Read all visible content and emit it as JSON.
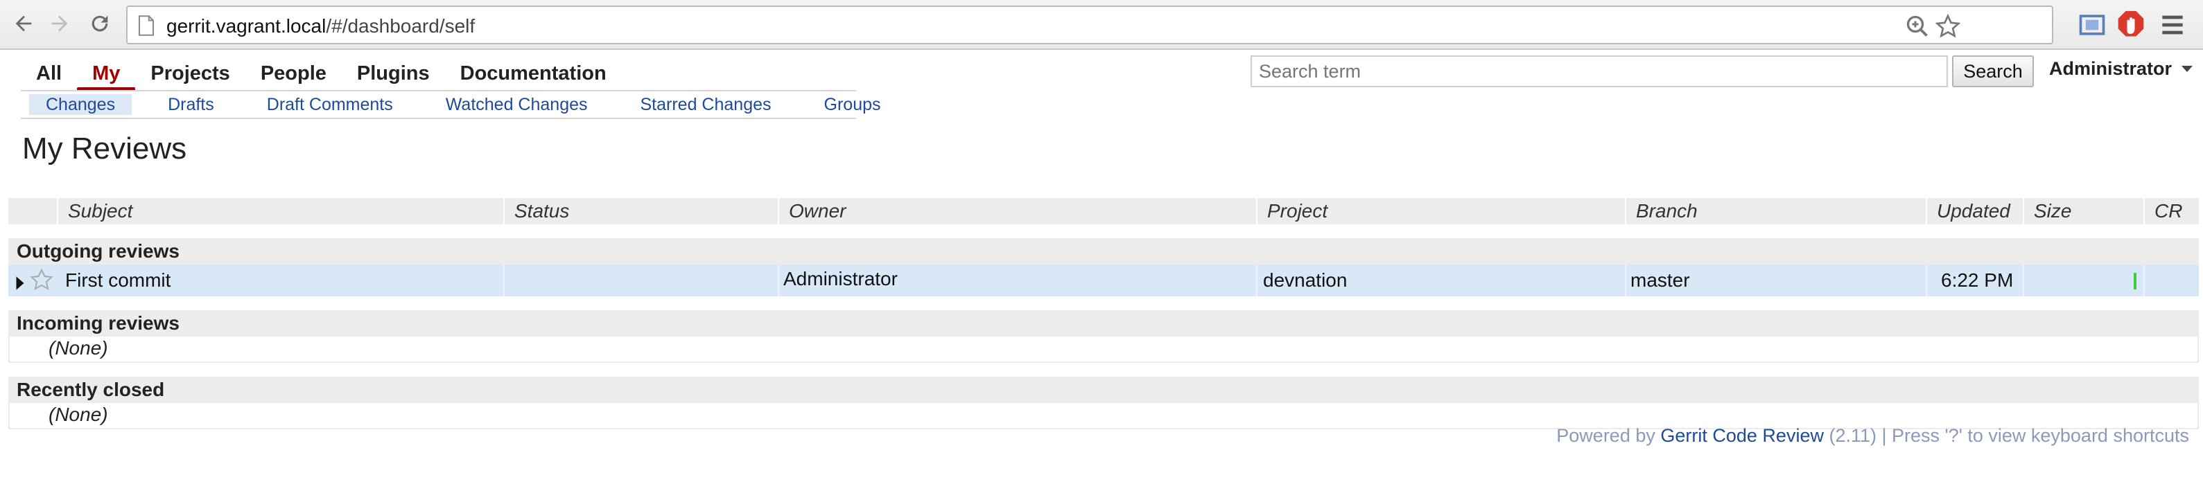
{
  "browser": {
    "url_host": "gerrit.vagrant.local",
    "url_path": "/#/dashboard/self"
  },
  "topmenu": {
    "items": [
      "All",
      "My",
      "Projects",
      "People",
      "Plugins",
      "Documentation"
    ],
    "active": "My"
  },
  "submenu": {
    "items": [
      "Changes",
      "Drafts",
      "Draft Comments",
      "Watched Changes",
      "Starred Changes",
      "Groups"
    ],
    "active": "Changes"
  },
  "search": {
    "placeholder": "Search term",
    "button_label": "Search"
  },
  "user": {
    "name": "Administrator"
  },
  "page": {
    "title": "My Reviews"
  },
  "table": {
    "columns": [
      "Subject",
      "Status",
      "Owner",
      "Project",
      "Branch",
      "Updated",
      "Size",
      "CR"
    ],
    "sections": [
      {
        "title": "Outgoing reviews",
        "rows": [
          {
            "subject": "First commit",
            "status": "",
            "owner": "Administrator",
            "project": "devnation",
            "branch": "master",
            "updated": "6:22 PM",
            "size": "",
            "size_bar_color": "#44cc44"
          }
        ]
      },
      {
        "title": "Incoming reviews",
        "empty_text": "(None)"
      },
      {
        "title": "Recently closed",
        "empty_text": "(None)"
      }
    ]
  },
  "footer": {
    "prefix": "Powered by ",
    "link": "Gerrit Code Review",
    "suffix": " (2.11) | Press '?' to view keyboard shortcuts"
  },
  "colors": {
    "active_menu": "#a00000",
    "link": "#1d4a9a",
    "row_highlight": "#d9e8f7",
    "header_bg": "#ececec"
  }
}
